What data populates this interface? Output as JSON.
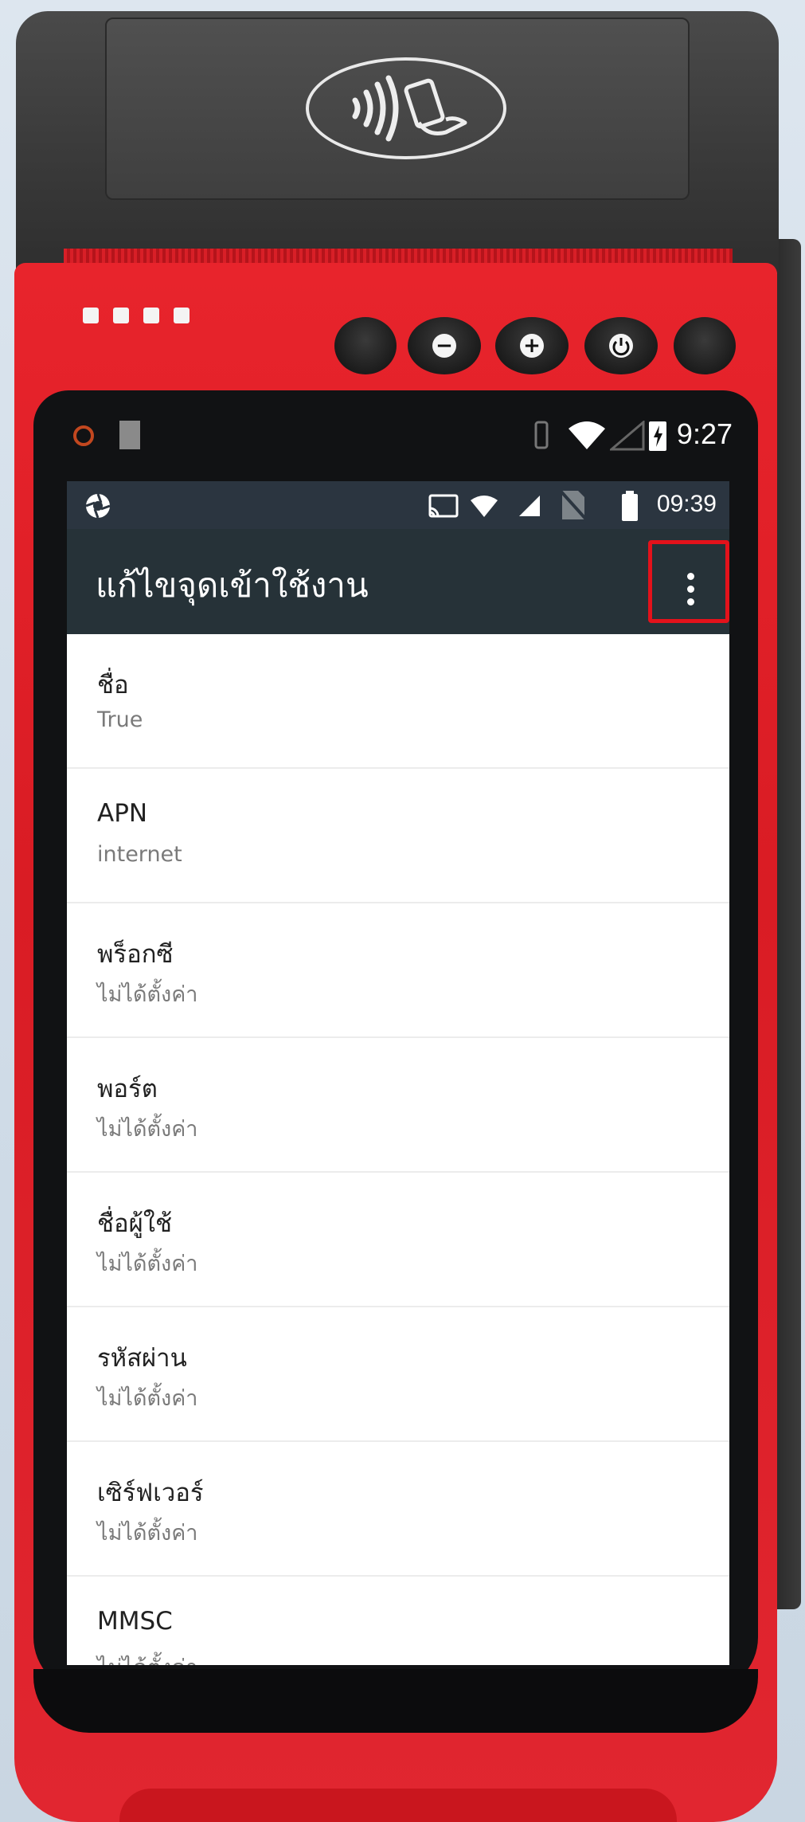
{
  "outer_status": {
    "time": "9:27"
  },
  "inner_status": {
    "time": "09:39"
  },
  "app_bar": {
    "title": "แก้ไขจุดเข้าใช้งาน"
  },
  "hardware_buttons": {
    "minus": "−",
    "plus": "+"
  },
  "apn_fields": [
    {
      "label": "ชื่อ",
      "value": "True"
    },
    {
      "label": "APN",
      "value": "internet"
    },
    {
      "label": "พร็อกซี",
      "value": "ไม่ได้ตั้งค่า"
    },
    {
      "label": "พอร์ต",
      "value": "ไม่ได้ตั้งค่า"
    },
    {
      "label": "ชื่อผู้ใช้",
      "value": "ไม่ได้ตั้งค่า"
    },
    {
      "label": "รหัสผ่าน",
      "value": "ไม่ได้ตั้งค่า"
    },
    {
      "label": "เซิร์ฟเวอร์",
      "value": "ไม่ได้ตั้งค่า"
    },
    {
      "label": "MMSC",
      "value": "ไม่ได้ตั้งค่า"
    }
  ],
  "colors": {
    "device_red": "#e1242c",
    "app_bar": "#263238",
    "highlight": "#e3121b"
  },
  "icons": {
    "nfc": "contactless-payment-icon",
    "overflow": "more-vert-icon"
  }
}
